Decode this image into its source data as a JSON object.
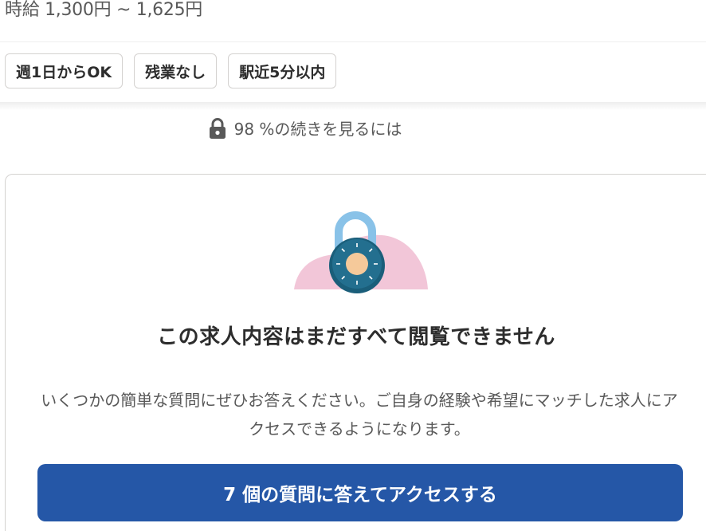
{
  "job": {
    "wage": "時給 1,300円 ~ 1,625円",
    "tags": [
      "週1日からOK",
      "残業なし",
      "駅近5分以内"
    ]
  },
  "paywall": {
    "remaining_text": "98 %の続きを見るには",
    "remaining_percent": 98,
    "title": "この求人内容はまだすべて閲覧できません",
    "description": "いくつかの簡単な質問にぜひお答えください。ご自身の経験や希望にマッチした求人にアクセスできるようになります。",
    "cta_label": "7 個の質問に答えてアクセスする",
    "icons": {
      "lock": "lock-icon",
      "illustration": "padlock-illustration"
    },
    "colors": {
      "cta": "#2557a7",
      "blob": "#f2c6d8",
      "shackle": "#89c2e8",
      "lock_body": "#1f6a8a",
      "dial": "#f5c99a"
    }
  }
}
